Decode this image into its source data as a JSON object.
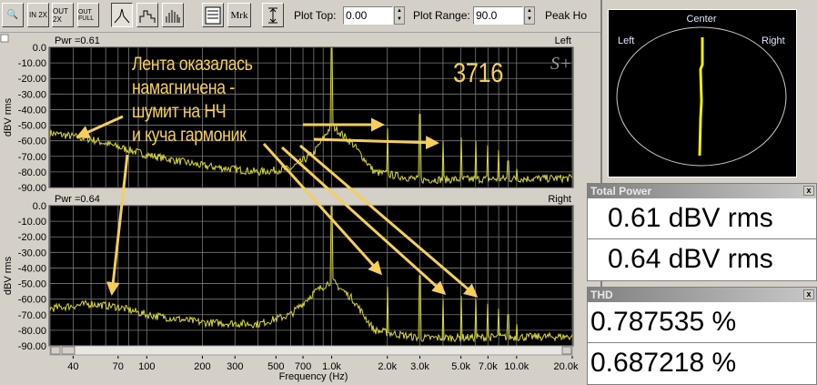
{
  "toolbar": {
    "zoom_icon": "magnifier-icon",
    "zoom_in_label": "IN 2X",
    "zoom_out_label": "OUT 2X",
    "zoom_full_label": "OUT FULL",
    "mrk_label": "Mrk",
    "plot_top_label": "Plot Top:",
    "plot_top_value": "0.00",
    "plot_range_label": "Plot Range:",
    "plot_range_value": "90.0",
    "peak_hold_label": "Peak Ho"
  },
  "plots": [
    {
      "channel": "Left",
      "pwr_label": "Pwr =0.61"
    },
    {
      "channel": "Right",
      "pwr_label": "Pwr =0.64"
    }
  ],
  "logo": "S+",
  "chart_data": {
    "type": "line",
    "xlabel": "Frequency (Hz)",
    "ylabel": "dBV rms",
    "xlim": [
      30,
      20000
    ],
    "ylim": [
      -90,
      0
    ],
    "xscale": "log",
    "y_ticks": [
      "0.0",
      "-10.00",
      "-20.00",
      "-30.00",
      "-40.00",
      "-50.00",
      "-60.00",
      "-70.00",
      "-80.00",
      "-90.00"
    ],
    "x_ticks": [
      {
        "v": 40,
        "l": "40"
      },
      {
        "v": 70,
        "l": "70"
      },
      {
        "v": 100,
        "l": "100"
      },
      {
        "v": 200,
        "l": "200"
      },
      {
        "v": 300,
        "l": "300"
      },
      {
        "v": 500,
        "l": "500"
      },
      {
        "v": 700,
        "l": "700"
      },
      {
        "v": 1000,
        "l": "1.0k"
      },
      {
        "v": 2000,
        "l": "2.0k"
      },
      {
        "v": 3000,
        "l": "3.0k"
      },
      {
        "v": 5000,
        "l": "5.0k"
      },
      {
        "v": 7000,
        "l": "7.0k"
      },
      {
        "v": 10000,
        "l": "10.0k"
      },
      {
        "v": 20000,
        "l": "20.0k"
      }
    ],
    "series": [
      {
        "name": "Left",
        "fundamental_hz": 1000,
        "fundamental_db": 0,
        "harmonics_db": [
          -52,
          -43,
          -60,
          -58,
          -60,
          -63,
          -66,
          -73,
          -78
        ],
        "floor": [
          [
            30,
            -55
          ],
          [
            50,
            -59
          ],
          [
            70,
            -64
          ],
          [
            100,
            -69
          ],
          [
            200,
            -76
          ],
          [
            400,
            -80
          ],
          [
            600,
            -78
          ],
          [
            800,
            -68
          ],
          [
            1000,
            -50
          ],
          [
            1300,
            -62
          ],
          [
            1700,
            -80
          ],
          [
            3000,
            -85
          ],
          [
            20000,
            -84
          ]
        ]
      },
      {
        "name": "Right",
        "fundamental_hz": 1000,
        "fundamental_db": 0,
        "harmonics_db": [
          -52,
          -45,
          -60,
          -58,
          -60,
          -63,
          -66,
          -70,
          -76
        ],
        "floor": [
          [
            30,
            -66
          ],
          [
            50,
            -63
          ],
          [
            70,
            -65
          ],
          [
            100,
            -70
          ],
          [
            200,
            -75
          ],
          [
            400,
            -76
          ],
          [
            600,
            -70
          ],
          [
            800,
            -56
          ],
          [
            1000,
            -48
          ],
          [
            1300,
            -60
          ],
          [
            1700,
            -80
          ],
          [
            3000,
            -85
          ],
          [
            20000,
            -84
          ]
        ]
      }
    ]
  },
  "scope": {
    "center": "Center",
    "left": "Left",
    "right": "Right"
  },
  "total_power": {
    "title": "Total Power",
    "values": [
      "0.61 dBV rms",
      "0.64 dBV rms"
    ]
  },
  "thd": {
    "title": "THD",
    "values": [
      "0.787535 %",
      "0.687218 %"
    ]
  },
  "annotation": {
    "lines": [
      "Лента оказалась",
      "намагничена -",
      "шумит на НЧ",
      "и куча гармоник"
    ],
    "number": "3716"
  },
  "colors": {
    "trace": "#d8d83a",
    "annotation": "#f4cf5c"
  }
}
